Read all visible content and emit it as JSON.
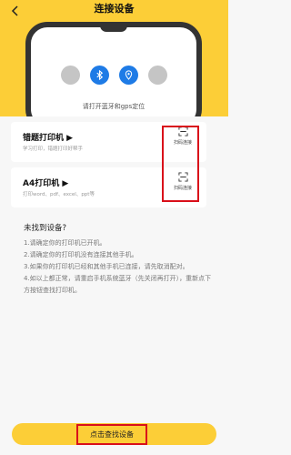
{
  "header": {
    "title": "连接设备",
    "back_icon": "chevron-left-icon"
  },
  "phone": {
    "hint": "请打开蓝牙和gps定位",
    "buttons": [
      "placeholder",
      "bluetooth-icon",
      "location-pin-icon",
      "placeholder"
    ]
  },
  "cards": [
    {
      "title": "错题打印机 ▶",
      "subtitle": "学习打印，错题打印好帮手",
      "scan_label": "扫码连接"
    },
    {
      "title": "A4打印机 ▶",
      "subtitle": "打印word、pdf、excel、ppt等",
      "scan_label": "扫码连接"
    }
  ],
  "help": {
    "title": "未找到设备?",
    "lines": [
      "1.请确定你的打印机已开机。",
      "2.请确定你的打印机没有连接其他手机。",
      "3.如果你的打印机已经和其他手机已连接，请先取消配对。",
      "4.如以上都正常，请重启手机系统蓝牙（先关闭再打开），重新点下方按钮查找打印机。"
    ]
  },
  "footer": {
    "find_button": "点击查找设备"
  },
  "colors": {
    "accent": "#fcce37",
    "highlight": "#d90f1a",
    "bluetooth": "#1e7be6"
  }
}
